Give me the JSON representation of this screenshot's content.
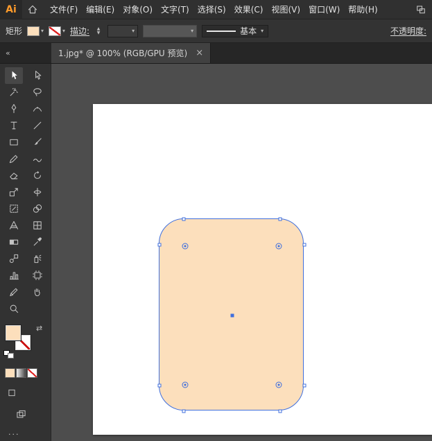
{
  "app": {
    "logo_text": "Ai"
  },
  "menubar": {
    "items": [
      "文件(F)",
      "编辑(E)",
      "对象(O)",
      "文字(T)",
      "选择(S)",
      "效果(C)",
      "视图(V)",
      "窗口(W)",
      "帮助(H)"
    ]
  },
  "controlbar": {
    "tool_label": "矩形",
    "stroke_label": "描边:",
    "brush_label": "基本",
    "opacity_label": "不透明度:"
  },
  "tab": {
    "title": "1.jpg* @ 100% (RGB/GPU 预览)"
  },
  "toolbar": {
    "tools": [
      {
        "name": "selection-tool",
        "active": true
      },
      {
        "name": "direct-selection-tool"
      },
      {
        "name": "magic-wand-tool"
      },
      {
        "name": "lasso-tool"
      },
      {
        "name": "pen-tool"
      },
      {
        "name": "curvature-tool"
      },
      {
        "name": "type-tool"
      },
      {
        "name": "line-segment-tool"
      },
      {
        "name": "rectangle-tool"
      },
      {
        "name": "paintbrush-tool"
      },
      {
        "name": "pencil-tool"
      },
      {
        "name": "shaper-tool"
      },
      {
        "name": "eraser-tool"
      },
      {
        "name": "rotate-tool"
      },
      {
        "name": "scale-tool"
      },
      {
        "name": "width-tool"
      },
      {
        "name": "free-transform-tool"
      },
      {
        "name": "shape-builder-tool"
      },
      {
        "name": "perspective-grid-tool"
      },
      {
        "name": "mesh-tool"
      },
      {
        "name": "gradient-tool"
      },
      {
        "name": "eyedropper-tool"
      },
      {
        "name": "blend-tool"
      },
      {
        "name": "symbol-sprayer-tool"
      },
      {
        "name": "column-graph-tool"
      },
      {
        "name": "artboard-tool"
      },
      {
        "name": "slice-tool"
      },
      {
        "name": "hand-tool"
      },
      {
        "name": "zoom-tool"
      }
    ]
  },
  "glyphs": {
    "caret": "▾",
    "collapse": "«",
    "close": "×",
    "spin_up": "▲",
    "spin_down": "▼",
    "swap": "⇄",
    "ellipsis": "···"
  },
  "colors": {
    "fill": "#fcdfbc",
    "selection": "#3f6fdd",
    "canvas_bg": "#4d4d4d",
    "artboard_bg": "#ffffff"
  }
}
